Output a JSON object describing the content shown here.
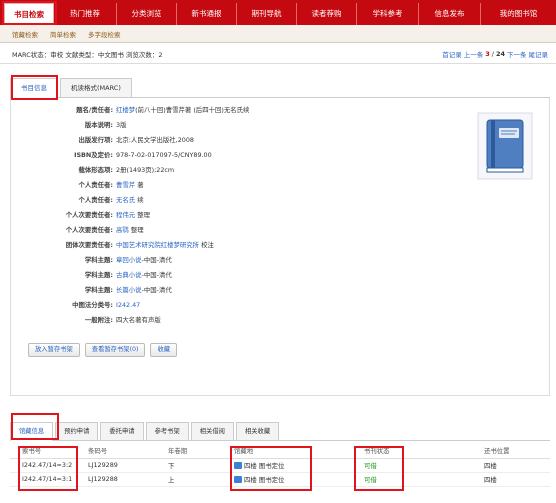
{
  "topnav": {
    "tabs": [
      {
        "label": "书目检索",
        "active": true
      },
      {
        "label": "热门推荐",
        "active": false
      },
      {
        "label": "分类浏览",
        "active": false
      },
      {
        "label": "新书通报",
        "active": false
      },
      {
        "label": "期刊导航",
        "active": false
      },
      {
        "label": "读者荐购",
        "active": false
      },
      {
        "label": "学科参考",
        "active": false
      },
      {
        "label": "信息发布",
        "active": false
      },
      {
        "label": "我的图书馆",
        "active": false
      }
    ],
    "subtabs": [
      "馆藏检索",
      "简单检索",
      "多字段检索"
    ]
  },
  "infobar": {
    "status": "MARC状态：审校  文献类型：中文图书  浏览次数：2",
    "first_record": "首记录",
    "prev": "上一条",
    "current": "3",
    "separator": "/",
    "total": "24",
    "next": "下一条",
    "last_record": "尾记录"
  },
  "detail_tabs": [
    "书目信息",
    "机读格式(MARC)"
  ],
  "fields": [
    {
      "label": "题名/责任者:",
      "link": "红楼梦",
      "text": "(前八十回)曹雪芹著 (后四十回)无名氏续"
    },
    {
      "label": "版本说明:",
      "link": "",
      "text": "3版"
    },
    {
      "label": "出版发行项:",
      "link": "",
      "text": "北京:人民文学出版社,2008"
    },
    {
      "label": "ISBN及定价:",
      "link": "",
      "text": "978-7-02-017097-5/CNY89.00"
    },
    {
      "label": "载体形态项:",
      "link": "",
      "text": "2册(1493页);22cm"
    },
    {
      "label": "个人责任者:",
      "link": "曹雪芹",
      "text": " 著"
    },
    {
      "label": "个人责任者:",
      "link": "无名氏",
      "text": " 续"
    },
    {
      "label": "个人次要责任者:",
      "link": "程伟元",
      "text": " 整理"
    },
    {
      "label": "个人次要责任者:",
      "link": "高鹗",
      "text": " 整理"
    },
    {
      "label": "团体次要责任者:",
      "link": "中国艺术研究院红楼梦研究所",
      "text": " 校注"
    },
    {
      "label": "学科主题:",
      "link": "章回小说",
      "text": "-中国-清代"
    },
    {
      "label": "学科主题:",
      "link": "古典小说",
      "text": "-中国-清代"
    },
    {
      "label": "学科主题:",
      "link": "长篇小说",
      "text": "-中国-清代"
    },
    {
      "label": "中图法分类号:",
      "link": "I242.47",
      "text": ""
    },
    {
      "label": "一般附注:",
      "link": "",
      "text": "四大名著有声版"
    }
  ],
  "buttons": [
    "放入暂存书架",
    "查看暂存书架(0)",
    "收藏"
  ],
  "holding_tabs": [
    "馆藏信息",
    "预约申请",
    "委托申请",
    "参考书架",
    "相关借阅",
    "相关收藏"
  ],
  "holdings": {
    "headers": [
      "索书号",
      "条码号",
      "年卷期",
      "馆藏地",
      "书刊状态",
      "还书位置"
    ],
    "rows": [
      [
        "I242.47/14=3:2",
        "LJ129289",
        "下",
        "四楼 图书定位",
        "可借",
        "四楼"
      ],
      [
        "I242.47/14=3:1",
        "LJ129288",
        "上",
        "四楼 图书定位",
        "可借",
        "四楼"
      ]
    ]
  },
  "colors": {
    "brand": "#c40a10",
    "link": "#2a63c2",
    "available": "#1a9b1a",
    "highlight": "#e0141c"
  }
}
